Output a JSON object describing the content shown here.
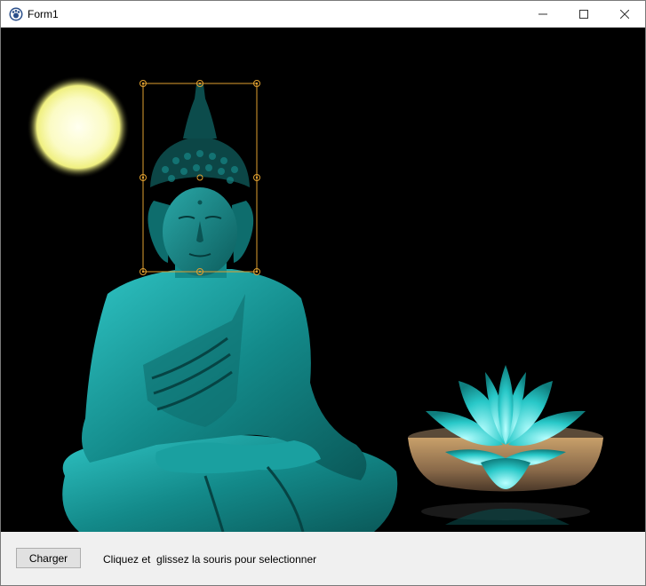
{
  "window": {
    "title": "Form1",
    "controls": {
      "minimize_icon": "minimize-icon",
      "maximize_icon": "maximize-icon",
      "close_icon": "close-icon"
    }
  },
  "canvas": {
    "background": "#000000",
    "image_description_icon": "buddha-image",
    "selection": {
      "color": "#e0a030",
      "handles": 8
    }
  },
  "bottom_panel": {
    "load_button_label": "Charger",
    "hint_text": "Cliquez et  glissez la souris pour selectionner"
  },
  "colors": {
    "teal": "#1aa8a8",
    "moon": "#fbfbc8",
    "panel": "#f0f0f0"
  }
}
